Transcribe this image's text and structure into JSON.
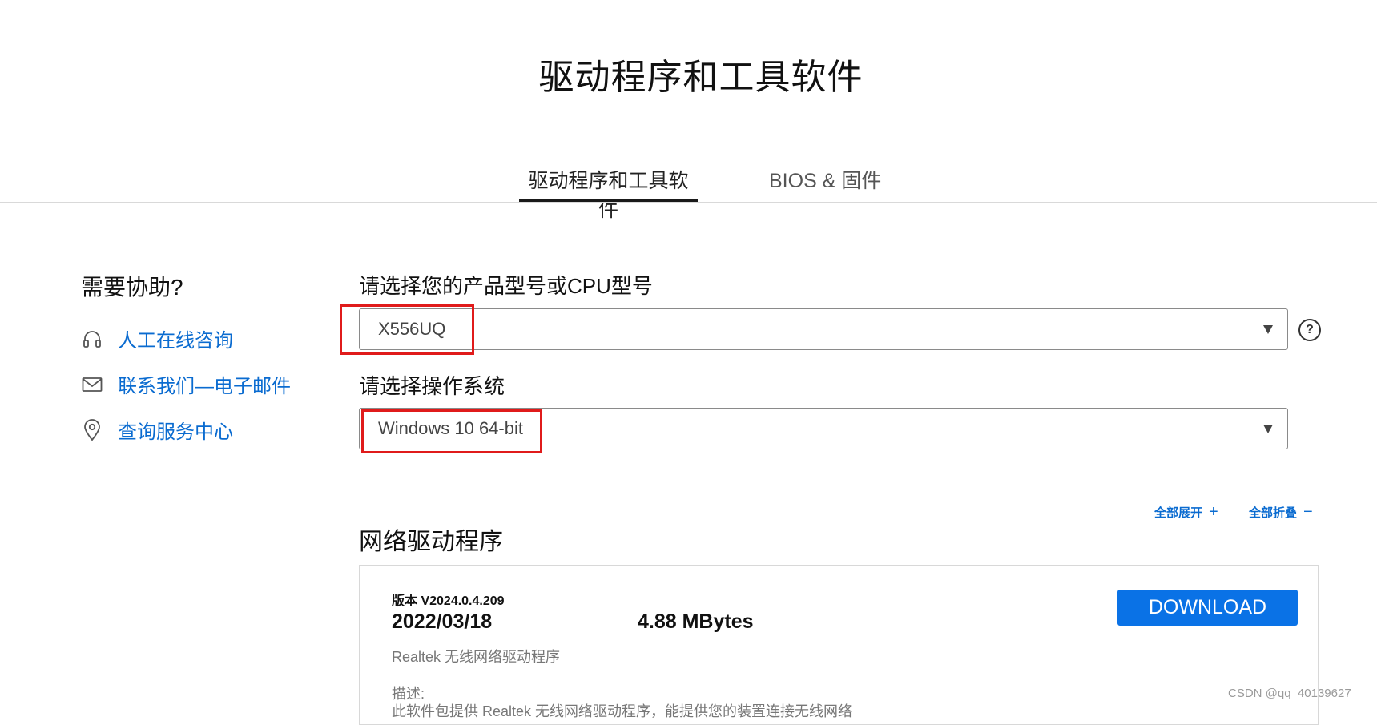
{
  "page": {
    "title": "驱动程序和工具软件"
  },
  "tabs": [
    {
      "label": "驱动程序和工具软件",
      "active": true
    },
    {
      "label": "BIOS & 固件",
      "active": false
    }
  ],
  "help": {
    "title": "需要协助?",
    "links": [
      {
        "icon": "headset-icon",
        "label": "人工在线咨询"
      },
      {
        "icon": "mail-icon",
        "label": "联系我们—电子邮件"
      },
      {
        "icon": "location-pin-icon",
        "label": "查询服务中心"
      }
    ]
  },
  "product_select": {
    "label": "请选择您的产品型号或CPU型号",
    "value": "X556UQ"
  },
  "os_select": {
    "label": "请选择操作系统",
    "value": "Windows 10 64-bit"
  },
  "controls": {
    "expand_all": "全部展开",
    "collapse_all": "全部折叠"
  },
  "section": {
    "title": "网络驱动程序"
  },
  "driver": {
    "version": "版本 V2024.0.4.209",
    "date": "2022/03/18",
    "size": "4.88 MBytes",
    "name": "Realtek 无线网络驱动程序",
    "description_label": "描述:",
    "description": "此软件包提供 Realtek 无线网络驱动程序，能提供您的装置连接无线网络",
    "download_label": "DOWNLOAD"
  },
  "watermark": "CSDN @qq_40139627",
  "colors": {
    "link": "#0a6bd0",
    "button": "#0a72e6",
    "highlight": "#e01b1b"
  }
}
